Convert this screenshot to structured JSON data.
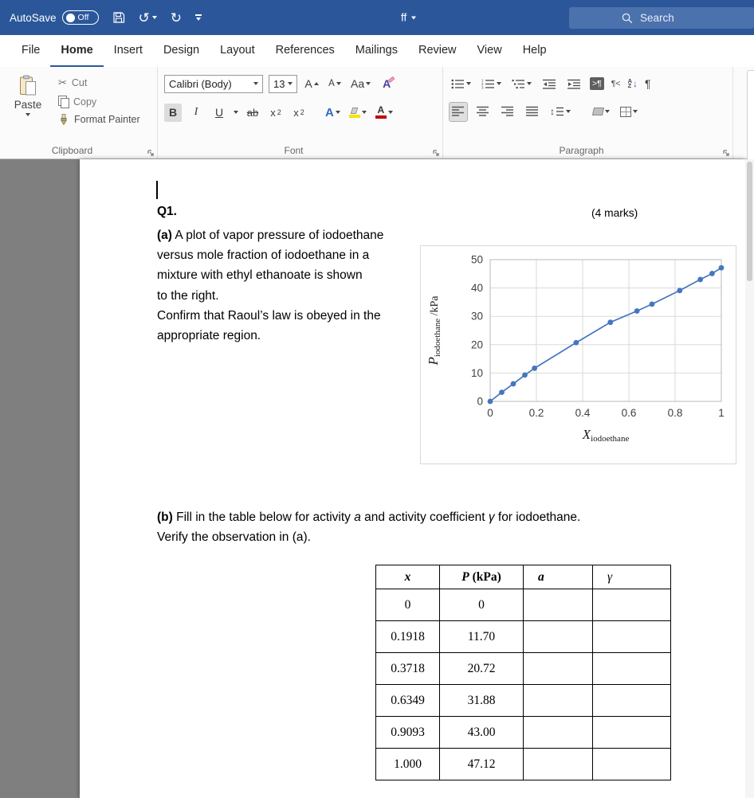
{
  "titlebar": {
    "autosave_label": "AutoSave",
    "autosave_state": "Off",
    "doc_title": "ff",
    "search_placeholder": "Search"
  },
  "tabs": [
    {
      "label": "File"
    },
    {
      "label": "Home"
    },
    {
      "label": "Insert"
    },
    {
      "label": "Design"
    },
    {
      "label": "Layout"
    },
    {
      "label": "References"
    },
    {
      "label": "Mailings"
    },
    {
      "label": "Review"
    },
    {
      "label": "View"
    },
    {
      "label": "Help"
    }
  ],
  "ribbon": {
    "clipboard": {
      "label": "Clipboard",
      "paste": "Paste",
      "cut": "Cut",
      "copy": "Copy",
      "format_painter": "Format Painter"
    },
    "font": {
      "label": "Font",
      "name": "Calibri (Body)",
      "size": "13"
    },
    "paragraph": {
      "label": "Paragraph"
    }
  },
  "document": {
    "q1_label": "Q1.",
    "marks": "(4 marks)",
    "a_prefix": "(a)",
    "a_lines": [
      " A plot of vapor pressure of iodoethane",
      "versus mole fraction of iodoethane in a",
      "mixture with ethyl ethanoate is shown",
      "to the right.",
      "Confirm that Raoul’s law is obeyed in the",
      "appropriate region."
    ],
    "b_prefix": "(b)",
    "b_seg1": " Fill in the table below for activity ",
    "b_italic1": "a",
    "b_seg2": " and activity coefficient ",
    "b_italic2": "γ",
    "b_seg3": " for iodoethane.",
    "b_line2": "Verify the observation in (a)."
  },
  "chart_data": {
    "type": "line",
    "title": "",
    "x": [
      0,
      0.05,
      0.1,
      0.15,
      0.1918,
      0.3718,
      0.52,
      0.6349,
      0.7,
      0.82,
      0.9093,
      0.96,
      1.0
    ],
    "y": [
      0,
      3.2,
      6.2,
      9.3,
      11.7,
      20.72,
      27.9,
      31.88,
      34.3,
      39.1,
      43.0,
      45.1,
      47.12
    ],
    "xlim": [
      0,
      1
    ],
    "ylim": [
      0,
      50
    ],
    "xticks": [
      "0",
      "0.2",
      "0.4",
      "0.6",
      "0.8",
      "1"
    ],
    "yticks": [
      "0",
      "10",
      "20",
      "30",
      "40",
      "50"
    ],
    "xlabel_main": "X",
    "xlabel_sub": "iodoethane",
    "ylabel_main": "P",
    "ylabel_sub": "iodoethane",
    "ylabel_suffix": " /kPa",
    "line_color": "#4576be",
    "grid": true,
    "legend": "none",
    "marker": "circle"
  },
  "table": {
    "headers": {
      "x": "x",
      "p_main": "P",
      "p_unit": " (kPa)",
      "a": "a",
      "gamma": "γ"
    },
    "rows": [
      {
        "x": "0",
        "p": "0",
        "a": "",
        "gamma": ""
      },
      {
        "x": "0.1918",
        "p": "11.70",
        "a": "",
        "gamma": ""
      },
      {
        "x": "0.3718",
        "p": "20.72",
        "a": "",
        "gamma": ""
      },
      {
        "x": "0.6349",
        "p": "31.88",
        "a": "",
        "gamma": ""
      },
      {
        "x": "0.9093",
        "p": "43.00",
        "a": "",
        "gamma": ""
      },
      {
        "x": "1.000",
        "p": "47.12",
        "a": "",
        "gamma": ""
      }
    ]
  }
}
